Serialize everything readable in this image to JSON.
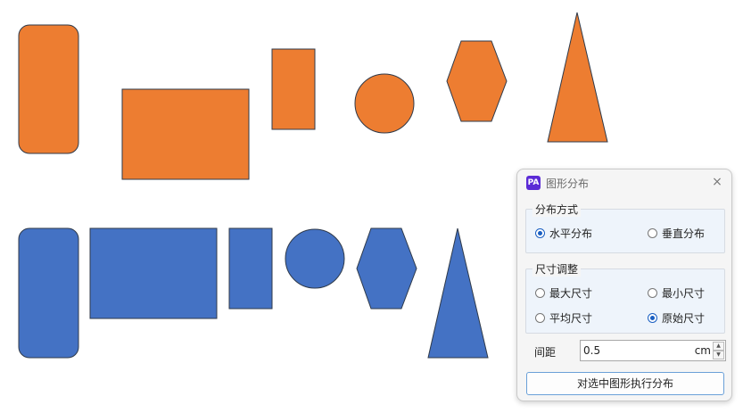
{
  "colors": {
    "orange": "#ed7d31",
    "blue": "#4472c4",
    "stroke": "#2f3a4a",
    "accent": "#1a5fc2"
  },
  "dialog": {
    "icon_text": "PA",
    "title": "图形分布",
    "close_icon": "×",
    "distribution_group": {
      "title": "分布方式",
      "options": [
        {
          "label": "水平分布",
          "selected": true
        },
        {
          "label": "垂直分布",
          "selected": false
        }
      ]
    },
    "size_group": {
      "title": "尺寸调整",
      "options": [
        {
          "label": "最大尺寸",
          "selected": false
        },
        {
          "label": "最小尺寸",
          "selected": false
        },
        {
          "label": "平均尺寸",
          "selected": false
        },
        {
          "label": "原始尺寸",
          "selected": true
        }
      ]
    },
    "spacing": {
      "label": "间距",
      "value": "0.5",
      "unit": "cm",
      "up": "▲",
      "down": "▼"
    },
    "execute_button": "对选中图形执行分布"
  }
}
